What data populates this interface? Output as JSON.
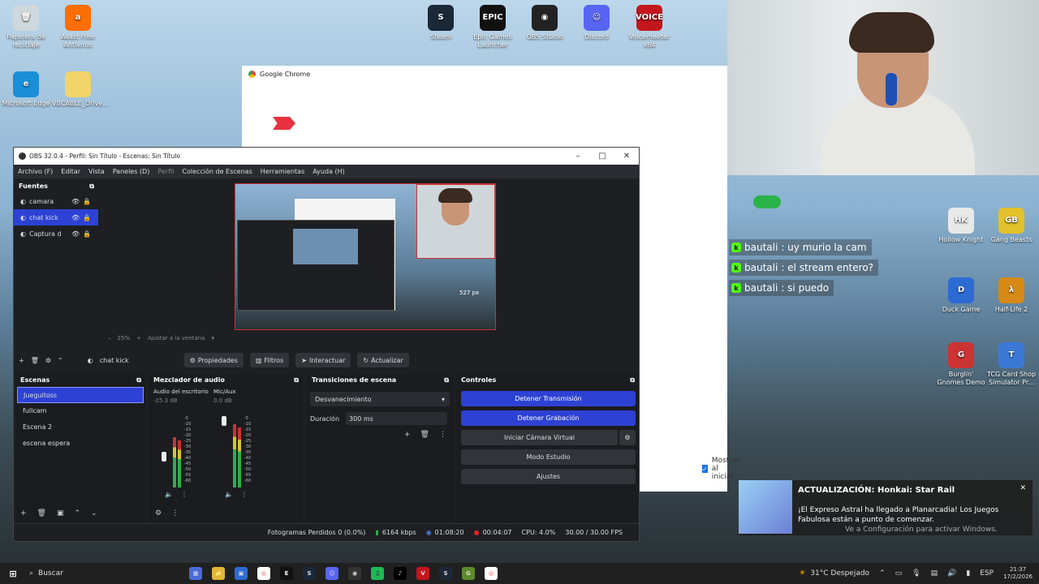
{
  "desktop": {
    "left_icons": [
      {
        "name": "recycle-bin-icon",
        "label": "Papelera de reciclaje",
        "color": "#cfd8dc",
        "glyph": "🗑"
      },
      {
        "name": "avast-icon",
        "label": "Avast Free Antivirus",
        "color": "#ff6e00",
        "glyph": "a"
      },
      {
        "name": "edge-icon",
        "label": "Microsoft Edge",
        "color": "#1a8fd8",
        "glyph": "e"
      },
      {
        "name": "folder-icon",
        "label": "VBCABLE_Drive...",
        "color": "#f2d46a",
        "glyph": ""
      }
    ],
    "top_icons": [
      {
        "name": "steam-icon",
        "label": "Steam",
        "color": "#1b2838",
        "glyph": "S"
      },
      {
        "name": "epic-icon",
        "label": "Epic Games Launcher",
        "color": "#111",
        "glyph": "EPIC"
      },
      {
        "name": "obs-icon",
        "label": "OBS Studio",
        "color": "#222",
        "glyph": "◉"
      },
      {
        "name": "discord-icon",
        "label": "Discord",
        "color": "#5865f2",
        "glyph": "☺"
      },
      {
        "name": "voicemeeter-icon",
        "label": "Voicemeeter x64",
        "color": "#c4161c",
        "glyph": "VOICE"
      }
    ],
    "right_icons": [
      {
        "name": "hollow-knight-icon",
        "label": "Hollow Knight",
        "color": "#e8e8e8",
        "glyph": "HK"
      },
      {
        "name": "gang-beasts-icon",
        "label": "Gang Beasts",
        "color": "#e2c12a",
        "glyph": "GB"
      },
      {
        "name": "duck-game-icon",
        "label": "Duck Game",
        "color": "#2d6bd4",
        "glyph": "D"
      },
      {
        "name": "half-life-icon",
        "label": "Half-Life 2",
        "color": "#d78a16",
        "glyph": "λ"
      },
      {
        "name": "burglin-gnomes-icon",
        "label": "Burglin' Gnomes Demo",
        "color": "#c33",
        "glyph": "G"
      },
      {
        "name": "tcg-icon",
        "label": "TCG Card Shop Simulator Pr...",
        "color": "#3a7ad6",
        "glyph": "T"
      }
    ]
  },
  "chrome": {
    "title": "Google Chrome",
    "show_on_start_label": "Mostrar al iniciar"
  },
  "obs": {
    "title": "OBS 32.0.4 - Perfil: Sin Título - Escenas: Sin Título",
    "menu": [
      "Archivo (F)",
      "Editar",
      "Vista",
      "Paneles (D)",
      "Perfil",
      "Colección de Escenas",
      "Herramientas",
      "Ayuda (H)"
    ],
    "sources_header": "Fuentes",
    "sources": [
      {
        "label": "camara",
        "selected": false
      },
      {
        "label": "chat kick",
        "selected": true
      },
      {
        "label": "Captura d",
        "selected": false
      }
    ],
    "preview_zoom": "25%",
    "preview_fit": "Ajustar a la ventana",
    "preview_size_label": "527 px",
    "selected_source": "chat kick",
    "toolbar": {
      "properties": "Propiedades",
      "filters": "Filtros",
      "interact": "Interactuar",
      "refresh": "Actualizar"
    },
    "scenes_header": "Escenas",
    "scenes": [
      {
        "label": "Jueguitoss",
        "selected": true
      },
      {
        "label": "fullcam",
        "selected": false
      },
      {
        "label": "Escena 2",
        "selected": false
      },
      {
        "label": "escena espera",
        "selected": false
      }
    ],
    "mixer_header": "Mezclador de audio",
    "mixer": [
      {
        "label": "Audio del escritorio",
        "db": "-25.3 dB"
      },
      {
        "label": "Mic/Aux",
        "db": "0.0 dB"
      }
    ],
    "meter_ticks": [
      "-5",
      "-10",
      "-15",
      "-20",
      "-25",
      "-30",
      "-35",
      "-40",
      "-45",
      "-50",
      "-55",
      "-60"
    ],
    "transitions_header": "Transiciones de escena",
    "transition": "Desvanecimiento",
    "duration_label": "Duración",
    "duration_value": "300 ms",
    "controls_header": "Controles",
    "controls": {
      "stop_stream": "Detener Transmisión",
      "stop_recording": "Detener Grabación",
      "virtual_cam": "Iniciar Cámara Virtual",
      "studio_mode": "Modo Estudio",
      "settings": "Ajustes"
    },
    "status": {
      "dropped": "Fotogramas Perdidos 0 (0.0%)",
      "bitrate": "6164 kbps",
      "stream_time": "01:08:20",
      "rec_time": "00:04:07",
      "cpu": "CPU: 4.0%",
      "fps": "30.00 / 30.00 FPS"
    }
  },
  "chat": [
    {
      "user": "bautali",
      "message": ": uy murio la cam"
    },
    {
      "user": "bautali",
      "message": ": el stream entero?"
    },
    {
      "user": "bautali",
      "message": ": si puedo"
    }
  ],
  "toast": {
    "title": "ACTUALIZACIÓN: Honkai: Star Rail",
    "body": "¡El Expreso Astral ha llegado a Planarcadia! Los Juegos Fabulosa están a punto de comenzar.",
    "watermark": "Ve a Configuración para activar Windows."
  },
  "taskbar": {
    "search": "Buscar",
    "weather": "31°C  Despejado",
    "lang": "ESP",
    "time": "21:37",
    "date": "17/2/2026"
  }
}
